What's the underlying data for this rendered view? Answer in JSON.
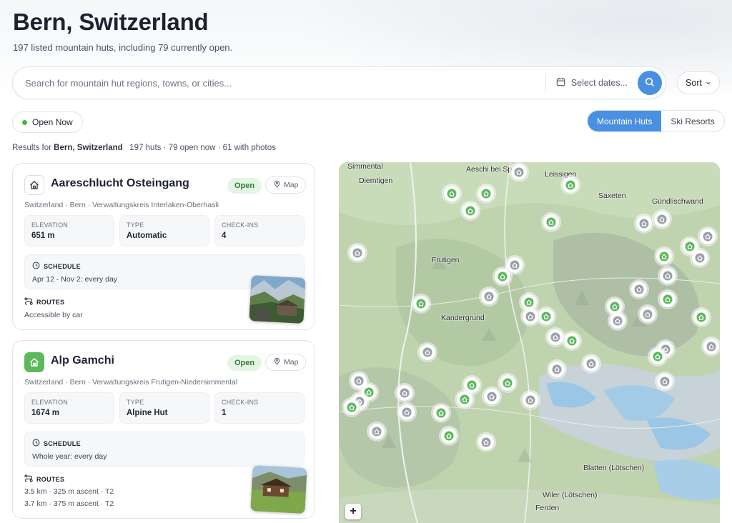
{
  "header": {
    "title": "Bern, Switzerland",
    "subtitle": "197 listed mountain huts, including 79 currently open."
  },
  "search": {
    "placeholder": "Search for mountain hut regions, towns, or cities...",
    "dates_label": "Select dates...",
    "sort_label": "Sort"
  },
  "filters": {
    "open_now_label": "Open Now",
    "tabs": [
      {
        "label": "Mountain Huts",
        "active": true
      },
      {
        "label": "Ski Resorts",
        "active": false
      }
    ]
  },
  "results": {
    "prefix": "Results for",
    "place": "Bern, Switzerland",
    "summary": "197 huts · 79 open now · 61 with photos"
  },
  "stat_labels": {
    "elevation": "ELEVATION",
    "type": "TYPE",
    "checkins": "CHECK-INS",
    "schedule": "SCHEDULE",
    "routes": "ROUTES",
    "map": "Map"
  },
  "huts": [
    {
      "name": "Aareschlucht Osteingang",
      "status": "Open",
      "location": "Switzerland · Bern · Verwaltungskreis Interlaken-Oberhasli",
      "elevation": "651 m",
      "type": "Automatic",
      "checkins": "4",
      "schedule": "Apr 12 - Nov 2: every day",
      "routes": [
        "Accessible by car"
      ]
    },
    {
      "name": "Alp Gamchi",
      "status": "Open",
      "location": "Switzerland · Bern · Verwaltungskreis Frutigen-Niedersimmental",
      "elevation": "1674 m",
      "type": "Alpine Hut",
      "checkins": "1",
      "schedule": "Whole year: every day",
      "routes": [
        "3.5 km · 325 m ascent · T2",
        "3.7 km · 375 m ascent · T2"
      ]
    }
  ],
  "map": {
    "zoom_in_label": "+",
    "labels": [
      "Simmental",
      "Aeschi bei Spiez",
      "Leissigen",
      "Diemtigen",
      "Saxeten",
      "Gündlischwand",
      "Frutigen",
      "Kandergrund",
      "Wiler (Lötschen)",
      "Ferden",
      "Blatten (Lötschen)"
    ]
  },
  "colors": {
    "accent": "#4a90e2",
    "open_green": "#43b649",
    "open_badge_bg": "#e4f5e6",
    "open_badge_text": "#2e7d32"
  }
}
